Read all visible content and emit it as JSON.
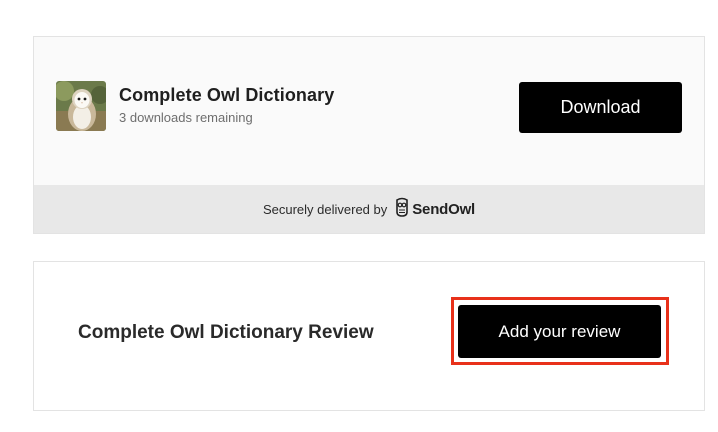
{
  "download_card": {
    "product_title": "Complete Owl Dictionary",
    "downloads_remaining": "3 downloads remaining",
    "download_label": "Download",
    "secure_text": "Securely delivered by",
    "brand_name": "SendOwl"
  },
  "review_card": {
    "title": "Complete Owl Dictionary Review",
    "add_review_label": "Add your review"
  },
  "colors": {
    "button_bg": "#000000",
    "highlight": "#e8311a",
    "footer_bg": "#e8e8e8"
  }
}
